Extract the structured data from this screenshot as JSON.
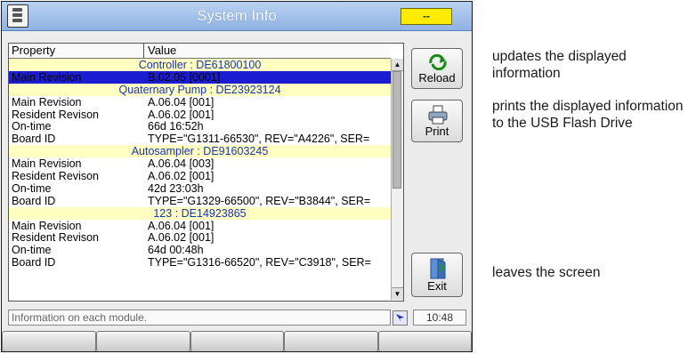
{
  "window": {
    "title": "System Info",
    "status_indicator": "--"
  },
  "table": {
    "headers": {
      "property": "Property",
      "value": "Value"
    },
    "rows": [
      {
        "type": "section",
        "label": "Controller : DE61800100"
      },
      {
        "type": "data",
        "property": "Main Revision",
        "value": "B.02.05 [0001]",
        "selected": true
      },
      {
        "type": "section",
        "label": "Quaternary Pump : DE23923124"
      },
      {
        "type": "data",
        "property": "Main Revision",
        "value": "A.06.04 [001]"
      },
      {
        "type": "data",
        "property": "Resident Revison",
        "value": "A.06.02 [001]"
      },
      {
        "type": "data",
        "property": "On-time",
        "value": "66d 16:52h"
      },
      {
        "type": "data",
        "property": "Board ID",
        "value": "TYPE=\"G1311-66530\", REV=\"A4226\", SER="
      },
      {
        "type": "section",
        "label": "Autosampler : DE91603245"
      },
      {
        "type": "data",
        "property": "Main Revision",
        "value": "A.06.04 [003]"
      },
      {
        "type": "data",
        "property": "Resident Revison",
        "value": "A.06.02 [001]"
      },
      {
        "type": "data",
        "property": "On-time",
        "value": "42d 23:03h"
      },
      {
        "type": "data",
        "property": "Board ID",
        "value": "TYPE=\"G1329-66500\", REV=\"B3844\", SER="
      },
      {
        "type": "section",
        "label": "123 : DE14923865"
      },
      {
        "type": "data",
        "property": "Main Revision",
        "value": "A.06.04 [001]"
      },
      {
        "type": "data",
        "property": "Resident Revison",
        "value": "A.06.02 [001]"
      },
      {
        "type": "data",
        "property": "On-time",
        "value": "64d 00:48h"
      },
      {
        "type": "data",
        "property": "Board ID",
        "value": "TYPE=\"G1316-66520\", REV=\"C3918\", SER="
      }
    ]
  },
  "buttons": {
    "reload": "Reload",
    "print": "Print",
    "exit": "Exit"
  },
  "statusbar": {
    "text": "Information on each module.",
    "time": "10:48"
  },
  "annotations": {
    "reload": "updates the displayed information",
    "print": "prints the displayed information to the USB Flash Drive",
    "exit": "leaves the screen"
  },
  "softkeys": [
    "",
    "",
    "",
    "",
    ""
  ],
  "colors": {
    "titlebar": "#8fb3e4",
    "section_row": "#ffffc2",
    "section_text": "#1a35b5",
    "selected_row": "#1c1cd0",
    "status_indicator": "#ffeb00"
  }
}
